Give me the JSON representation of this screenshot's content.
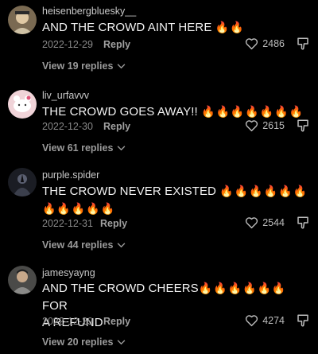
{
  "comments": [
    {
      "username": "heisenbergbluesky__",
      "text": "AND THE CROWD AINT HERE",
      "emojis": "🔥🔥",
      "date": "2022-12-29",
      "reply_label": "Reply",
      "likes": "2486",
      "view_replies": "View 19 replies"
    },
    {
      "username": "liv_urfavvv",
      "text": "THE CROWD GOES AWAY!!",
      "emojis": "🔥🔥🔥🔥🔥🔥🔥",
      "date": "2022-12-30",
      "reply_label": "Reply",
      "likes": "2615",
      "view_replies": "View 61 replies"
    },
    {
      "username": "purple.spider",
      "text": "THE CROWD NEVER EXISTED",
      "emojis": "🔥🔥🔥🔥🔥🔥",
      "emojis2": "🔥🔥🔥🔥🔥",
      "date": "2022-12-31",
      "reply_label": "Reply",
      "likes": "2544",
      "view_replies": "View 44 replies"
    },
    {
      "username": "jamesyayng",
      "text_pre": "AND THE CROWD CHEERS",
      "emojis": "🔥🔥🔥🔥🔥🔥",
      "text_post": "FOR",
      "text_line2": "A REFUND",
      "date": "2022-12-29",
      "reply_label": "Reply",
      "likes": "4274",
      "view_replies": "View 20 replies"
    }
  ],
  "colors": {
    "background": "#000000",
    "text": "#f2f2f2",
    "meta": "#8a8a8a",
    "fire": "#ff7a1a"
  }
}
